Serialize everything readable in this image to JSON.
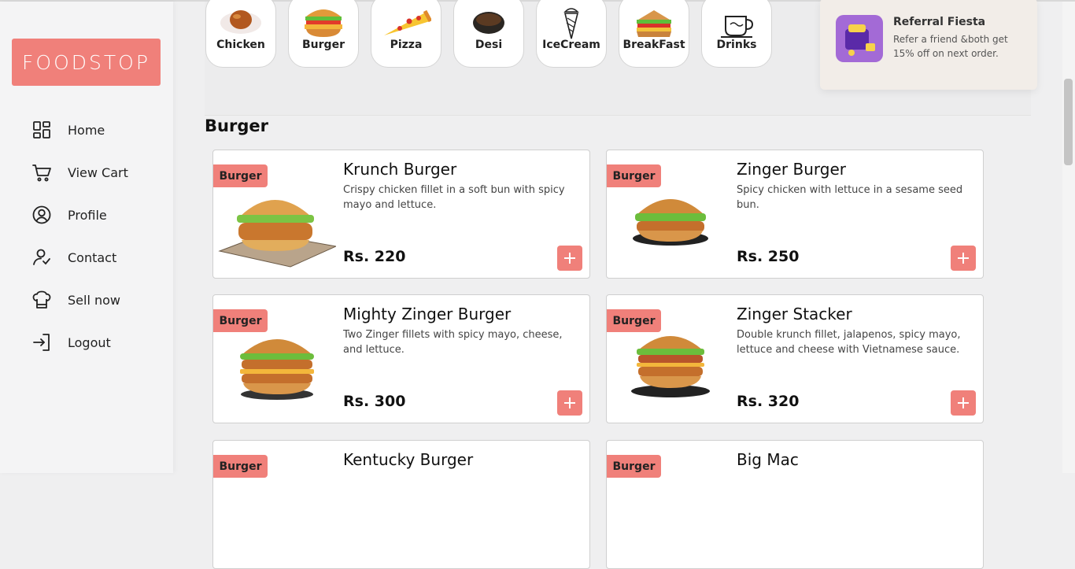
{
  "brand": {
    "logo_text": "FOODSTOP",
    "accent": "#f0807a"
  },
  "sidebar": {
    "items": [
      {
        "label": "Home",
        "icon": "grid-icon"
      },
      {
        "label": "View Cart",
        "icon": "cart-icon"
      },
      {
        "label": "Profile",
        "icon": "user-circle-icon"
      },
      {
        "label": "Contact",
        "icon": "contact-icon"
      },
      {
        "label": "Sell now",
        "icon": "chef-hat-icon"
      },
      {
        "label": "Logout",
        "icon": "logout-icon"
      }
    ]
  },
  "categories": [
    {
      "label": "Chicken",
      "icon": "chicken-icon"
    },
    {
      "label": "Burger",
      "icon": "burger-icon"
    },
    {
      "label": "Pizza",
      "icon": "pizza-icon"
    },
    {
      "label": "Desi",
      "icon": "desi-bowl-icon"
    },
    {
      "label": "IceCream",
      "icon": "icecream-icon"
    },
    {
      "label": "BreakFast",
      "icon": "sandwich-icon"
    },
    {
      "label": "Drinks",
      "icon": "cup-icon"
    }
  ],
  "referral": {
    "title": "Referral Fiesta",
    "text": "Refer a friend &both get 15% off on next order."
  },
  "section": {
    "title": "Burger"
  },
  "products": [
    {
      "badge": "Burger",
      "name": "Krunch Burger",
      "desc": "Crispy chicken fillet in a soft bun with spicy mayo and lettuce.",
      "price": "Rs. 220"
    },
    {
      "badge": "Burger",
      "name": "Zinger Burger",
      "desc": "Spicy chicken with lettuce in a sesame seed bun.",
      "price": "Rs. 250"
    },
    {
      "badge": "Burger",
      "name": "Mighty Zinger Burger",
      "desc": "Two Zinger fillets with spicy mayo, cheese, and lettuce.",
      "price": "Rs. 300"
    },
    {
      "badge": "Burger",
      "name": "Zinger Stacker",
      "desc": "Double krunch fillet, jalapenos, spicy mayo, lettuce and cheese with Vietnamese sauce.",
      "price": "Rs. 320"
    },
    {
      "badge": "Burger",
      "name": "Kentucky Burger",
      "desc": "",
      "price": ""
    },
    {
      "badge": "Burger",
      "name": "Big Mac",
      "desc": "",
      "price": ""
    }
  ]
}
